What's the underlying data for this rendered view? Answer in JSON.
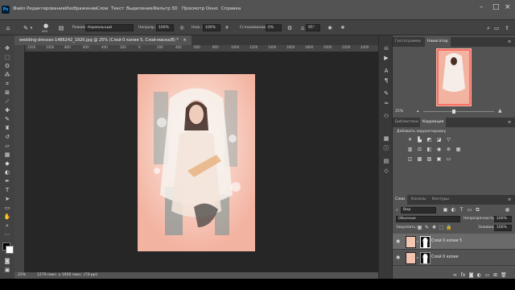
{
  "app": {
    "logo": "Ps"
  },
  "menu": [
    "Файл",
    "Редактирование",
    "Изображение",
    "Слои",
    "Текст",
    "Выделение",
    "Фильтр",
    "3D",
    "Просмотр",
    "Окно",
    "Справка"
  ],
  "options": {
    "mode_label": "Режим:",
    "mode_value": "Нормальный",
    "opacity_label": "Непрозр.:",
    "opacity_value": "100%",
    "pressure_label": "Наж.:",
    "pressure_value": "100%",
    "smoothing_label": "Сглаживание:",
    "smoothing_value": "0%",
    "angle_value": "95°",
    "brush_size": "400"
  },
  "document": {
    "tab_title": "wedding-dresses-1486242_1920.jpg @ 25% (Слой 0 копия 5, Слой-маска/8) *",
    "close": "×"
  },
  "ruler_ticks": [
    "1200",
    "1000",
    "800",
    "600",
    "400",
    "200",
    "0",
    "200",
    "400",
    "600",
    "800",
    "1000",
    "1200",
    "1400",
    "1600",
    "1800",
    "2000",
    "2200",
    "2400"
  ],
  "status": {
    "zoom": "25%",
    "doc_info": "1279 пикс. x 1920 пикс. (72 ppi)"
  },
  "panels": {
    "top_tabs": [
      "Гистограмма",
      "Навигатор"
    ],
    "navigator_zoom": "25%",
    "mid_tabs": [
      "Библиотеки",
      "Коррекция"
    ],
    "add_adjustment": "Добавить корректировку",
    "layers_tabs": [
      "Слои",
      "Каналы",
      "Контуры"
    ],
    "kind_filter": "Вид",
    "blend_mode": "Обычные",
    "opacity_label": "Непрозрачность:",
    "opacity_value": "100%",
    "lock_label": "Закрепить:",
    "fill_label": "Заливка:",
    "fill_value": "100%",
    "layers": [
      {
        "name": "Слой 0 копия 5"
      },
      {
        "name": "Слой 0 копия"
      }
    ]
  },
  "colors": {
    "accent": "#31a8ff",
    "photo_bg": "#f4b6a4"
  }
}
